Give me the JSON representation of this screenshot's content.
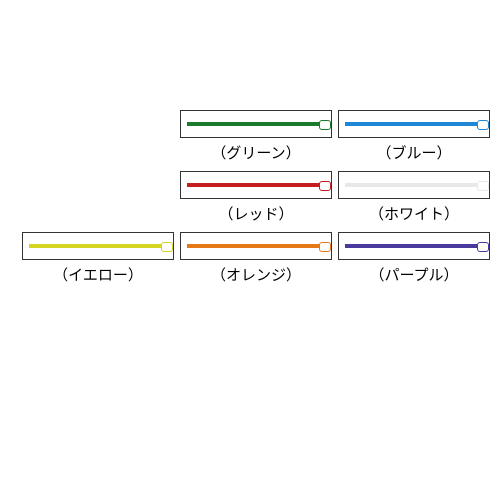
{
  "colors": {
    "green": {
      "label": "（グリーン）",
      "hex": "#1a7a2e"
    },
    "blue": {
      "label": "（ブルー）",
      "hex": "#1e88d6"
    },
    "red": {
      "label": "（レッド）",
      "hex": "#c41e1e"
    },
    "white": {
      "label": "（ホワイト）",
      "hex": "#e8e8e8"
    },
    "yellow": {
      "label": "（イエロー）",
      "hex": "#d4d422"
    },
    "orange": {
      "label": "（オレンジ）",
      "hex": "#e67817"
    },
    "purple": {
      "label": "（パープル）",
      "hex": "#4a3a9e"
    }
  }
}
